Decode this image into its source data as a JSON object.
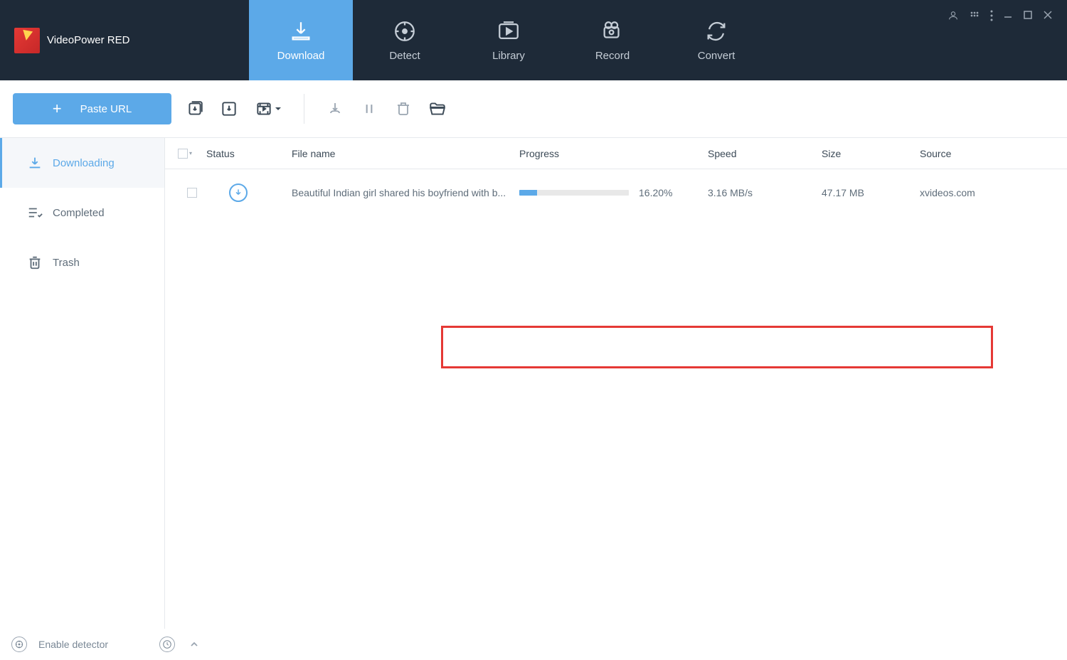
{
  "app": {
    "title": "VideoPower RED"
  },
  "topnav": [
    {
      "label": "Download",
      "active": true
    },
    {
      "label": "Detect",
      "active": false
    },
    {
      "label": "Library",
      "active": false
    },
    {
      "label": "Record",
      "active": false
    },
    {
      "label": "Convert",
      "active": false
    }
  ],
  "toolbar": {
    "paste_url": "Paste URL"
  },
  "sidebar": [
    {
      "label": "Downloading",
      "active": true
    },
    {
      "label": "Completed",
      "active": false
    },
    {
      "label": "Trash",
      "active": false
    }
  ],
  "columns": {
    "status": "Status",
    "file": "File name",
    "progress": "Progress",
    "speed": "Speed",
    "size": "Size",
    "source": "Source"
  },
  "rows": [
    {
      "filename": "Beautiful Indian girl shared his boyfriend with b...",
      "progress_pct": 16.2,
      "progress_text": "16.20%",
      "speed": "3.16 MB/s",
      "size": "47.17 MB",
      "source": "xvideos.com"
    }
  ],
  "footer": {
    "detector": "Enable detector"
  }
}
